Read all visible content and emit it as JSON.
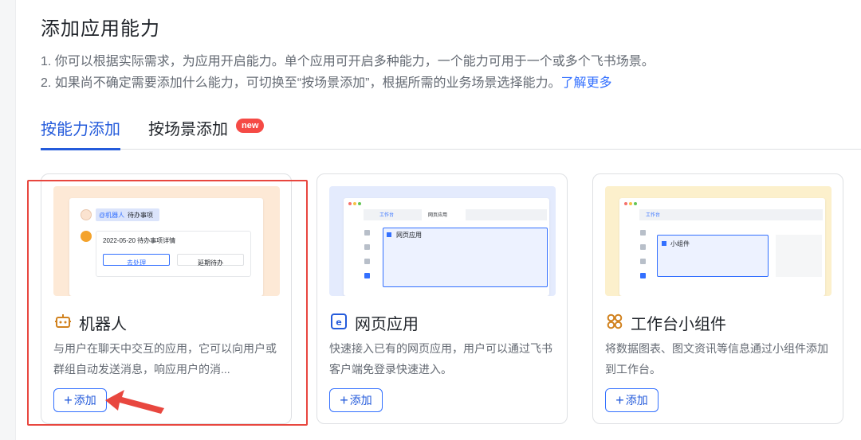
{
  "header": {
    "title": "添加应用能力",
    "desc_line1": "1. 你可以根据实际需求，为应用开启能力。单个应用可开启多种能力，一个能力可用于一个或多个飞书场景。",
    "desc_line2_prefix": "2. 如果尚不确定需要添加什么能力，可切换至“按场景添加”，根据所需的业务场景选择能力。",
    "learn_more": "了解更多"
  },
  "tabs": [
    {
      "label": "按能力添加",
      "active": true
    },
    {
      "label": "按场景添加",
      "badge": "new",
      "active": false
    }
  ],
  "cards": [
    {
      "title": "机器人",
      "icon": "robot-icon",
      "desc": "与用户在聊天中交互的应用，它可以向用户或群组自动发送消息，响应用户的消...",
      "add_label": "添加",
      "highlighted": true,
      "preview": {
        "bot_tag": "@机器人",
        "todo_title": "待办事项",
        "todo_date": "2022-05-20 待办事项详情",
        "btn_primary": "去处理",
        "btn_secondary": "延期待办"
      }
    },
    {
      "title": "网页应用",
      "icon": "web-app-icon",
      "desc": "快速接入已有的网页应用，用户可以通过飞书客户端免登录快速进入。",
      "add_label": "添加",
      "highlighted": false,
      "preview": {
        "tab1": "工作台",
        "tab2": "网页应用",
        "panel": "网页应用"
      }
    },
    {
      "title": "工作台小组件",
      "icon": "widget-icon",
      "desc": "将数据图表、图文资讯等信息通过小组件添加到工作台。",
      "add_label": "添加",
      "highlighted": false,
      "preview": {
        "tab1": "工作台",
        "panel": "小组件"
      }
    }
  ],
  "colors": {
    "accent": "#245bdb",
    "link": "#3370ff",
    "highlight": "#e8473f",
    "badge": "#f54a45"
  }
}
